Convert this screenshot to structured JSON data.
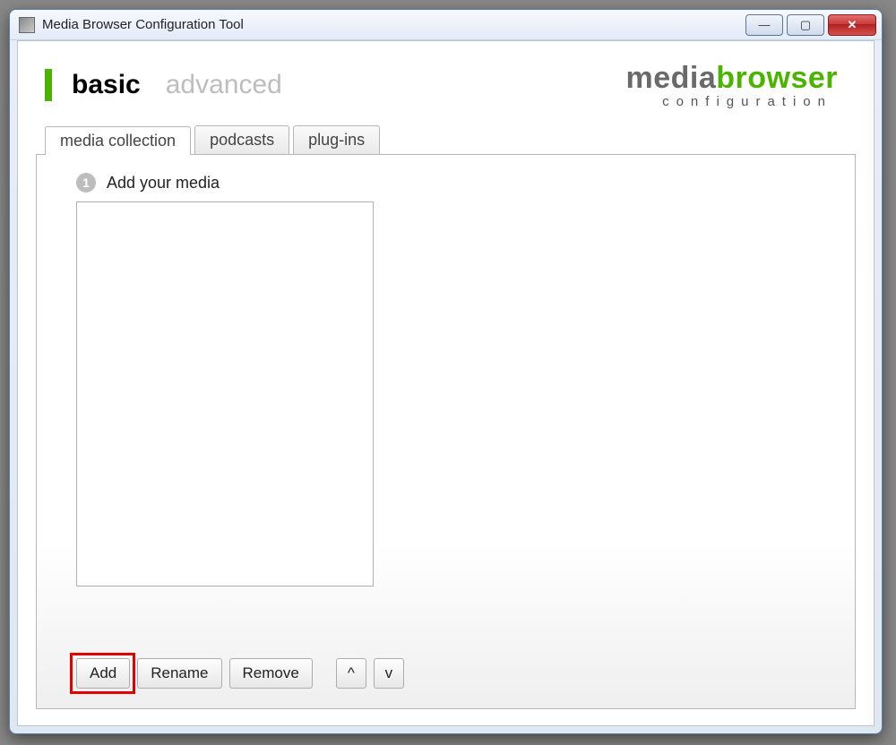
{
  "window": {
    "title": "Media Browser Configuration Tool"
  },
  "nav": {
    "items": [
      {
        "label": "basic",
        "active": true
      },
      {
        "label": "advanced",
        "active": false
      }
    ]
  },
  "logo": {
    "part1": "media",
    "part2": "browser",
    "sub": "configuration"
  },
  "tabs": [
    {
      "label": "media collection",
      "active": true
    },
    {
      "label": "podcasts",
      "active": false
    },
    {
      "label": "plug-ins",
      "active": false
    }
  ],
  "step": {
    "number": "1",
    "label": "Add your media"
  },
  "buttons": {
    "add": "Add",
    "rename": "Rename",
    "remove": "Remove",
    "up": "^",
    "down": "v"
  },
  "win_controls": {
    "min": "—",
    "max": "▢",
    "close": "✕"
  }
}
